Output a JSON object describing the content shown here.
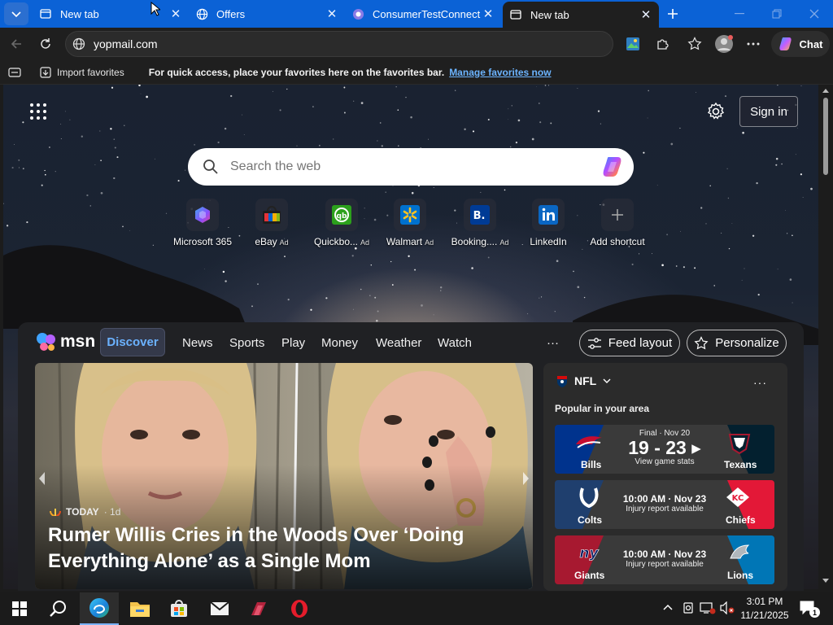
{
  "tabs": [
    {
      "label": "New tab",
      "icon": "newtab-icon",
      "active": false
    },
    {
      "label": "Offers",
      "icon": "globe-icon",
      "active": false
    },
    {
      "label": "ConsumerTestConnect -",
      "icon": "ctc-favicon-icon",
      "active": false
    },
    {
      "label": "New tab",
      "icon": "newtab-icon",
      "active": true
    }
  ],
  "address": {
    "url": "yopmail.com"
  },
  "toolbar": {
    "chat_label": "Chat"
  },
  "favorites_bar": {
    "import_label": "Import favorites",
    "message": "For quick access, place your favorites here on the favorites bar.",
    "manage_link": "Manage favorites now"
  },
  "ntp": {
    "sign_in": "Sign in",
    "search_placeholder": "Search the web"
  },
  "quick_links": [
    {
      "label": "Microsoft 365",
      "ad": ""
    },
    {
      "label": "eBay",
      "ad": "Ad"
    },
    {
      "label": "Quickbo...",
      "ad": "Ad"
    },
    {
      "label": "Walmart",
      "ad": "Ad"
    },
    {
      "label": "Booking....",
      "ad": "Ad"
    },
    {
      "label": "LinkedIn",
      "ad": ""
    },
    {
      "label": "Add shortcut",
      "ad": ""
    }
  ],
  "msn": {
    "logo": "msn",
    "nav": [
      "Discover",
      "News",
      "Sports",
      "Play",
      "Money",
      "Weather",
      "Watch"
    ],
    "more": "···",
    "feed_layout": "Feed layout",
    "personalize": "Personalize"
  },
  "hero": {
    "source": "TODAY",
    "age": "· 1d",
    "headline": "Rumer Willis Cries in the Woods Over ‘Doing Everything Alone’ as a Single Mom"
  },
  "nfl": {
    "title": "NFL",
    "subtitle": "Popular in your area",
    "games": [
      {
        "home": "Bills",
        "away": "Texans",
        "line1": "Final · Nov 20",
        "line2": "19 - 23",
        "line3": "View game stats",
        "home_color": "#0a3a8c",
        "away_color": "#0b1f3a"
      },
      {
        "home": "Colts",
        "away": "Chiefs",
        "line1": "",
        "line2": "10:00 AM · Nov 23",
        "line3": "Injury report available",
        "home_color": "#123a72",
        "away_color": "#c8102e"
      },
      {
        "home": "Giants",
        "away": "Lions",
        "line1": "",
        "line2": "10:00 AM · Nov 23",
        "line3": "Injury report available",
        "home_color": "#a71930",
        "away_color": "#0076b6"
      }
    ]
  },
  "taskbar": {
    "time": "3:01 PM",
    "date": "11/21/2025",
    "notifications": "1"
  }
}
